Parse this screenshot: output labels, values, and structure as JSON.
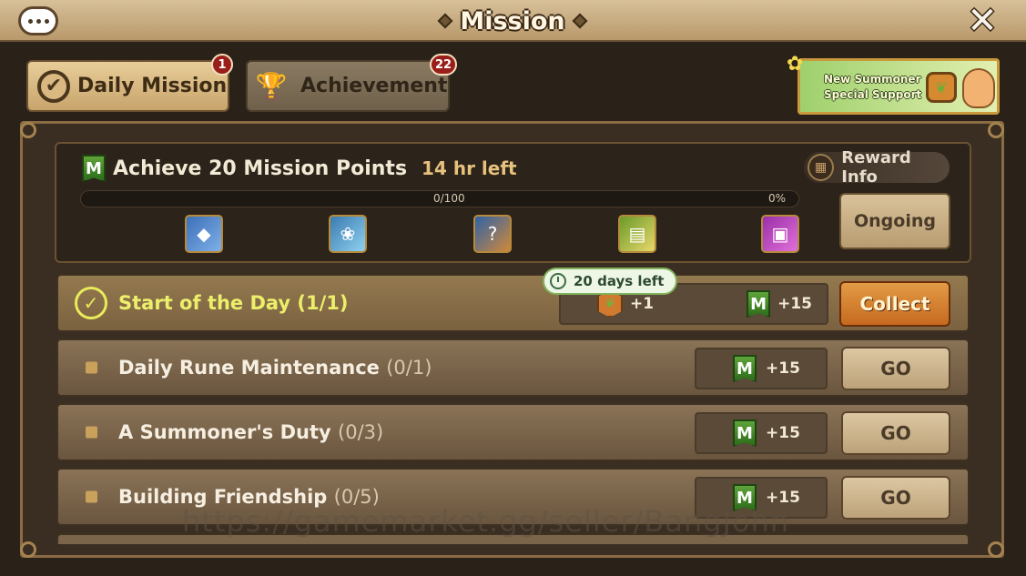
{
  "header": {
    "title": "Mission",
    "chat_icon": "chat-bubble-icon",
    "close_icon": "close-icon"
  },
  "tabs": [
    {
      "label": "Daily Mission",
      "badge": "1",
      "active": true
    },
    {
      "label": "Achievement",
      "badge": "22",
      "active": false
    }
  ],
  "promo": {
    "line1": "New Summoner",
    "line2": "Special Support"
  },
  "summary": {
    "title": "Achieve 20 Mission Points",
    "time_left": "14 hr left",
    "progress_text": "0/100",
    "percent_text": "0%",
    "progress_value": 0,
    "reward_info_label": "Reward Info",
    "status_label": "Ongoing",
    "milestone_icons": [
      "rune-bundle-icon",
      "angelmon-icon",
      "mystery-scroll-icon",
      "scroll-icon",
      "rune-chest-icon"
    ]
  },
  "tooltip": {
    "text": "20 days left"
  },
  "missions": [
    {
      "title": "Start of the Day",
      "progress": "(1/1)",
      "done": true,
      "extra_reward": "+1",
      "mp_reward": "+15",
      "action": "Collect"
    },
    {
      "title": "Daily Rune Maintenance",
      "progress": "(0/1)",
      "done": false,
      "mp_reward": "+15",
      "action": "GO"
    },
    {
      "title": "A Summoner's Duty",
      "progress": "(0/3)",
      "done": false,
      "mp_reward": "+15",
      "action": "GO"
    },
    {
      "title": "Building Friendship",
      "progress": "(0/5)",
      "done": false,
      "mp_reward": "+15",
      "action": "GO"
    }
  ],
  "watermark": "https://gamemarket.gg/seller/BangJohn",
  "colors": {
    "accent_green": "#8fc34c",
    "collect_orange": "#d4802f",
    "done_yellow": "#ecef6b"
  }
}
